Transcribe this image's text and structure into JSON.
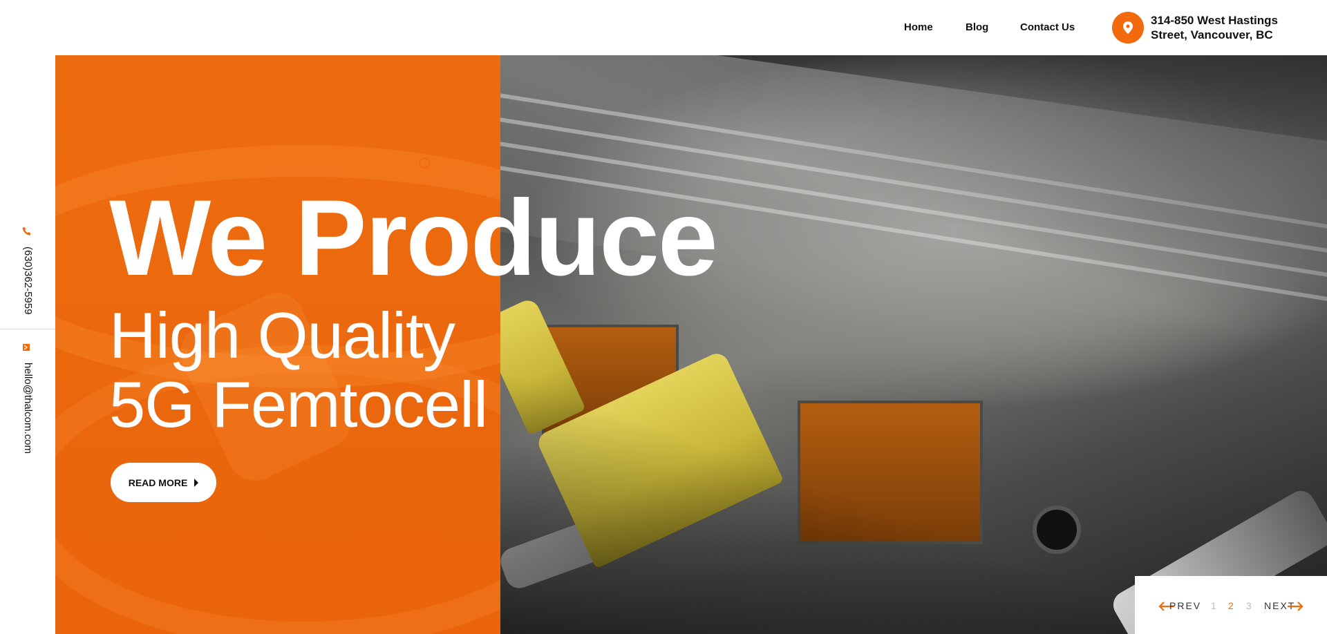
{
  "header": {
    "nav": [
      {
        "label": "Home"
      },
      {
        "label": "Blog"
      },
      {
        "label": "Contact Us"
      }
    ],
    "address_line1": "314-850 West Hastings",
    "address_line2": "Street, Vancouver, BC",
    "location_icon": "location-pin-icon"
  },
  "sidebar": {
    "phone": "(630)362-5959",
    "email": "hello@thalcom.com",
    "phone_icon": "phone-icon",
    "email_icon": "email-icon"
  },
  "hero": {
    "title": "We Produce",
    "subtitle_line1": "High Quality",
    "subtitle_line2": "5G Femtocell",
    "cta_label": "READ MORE"
  },
  "pager": {
    "prev_label": "PREV",
    "next_label": "NEXT",
    "pages": [
      "1",
      "2",
      "3"
    ],
    "current": "2"
  },
  "colors": {
    "accent": "#f26a0d",
    "hero_panel": "#eb670d",
    "text": "#111111",
    "background": "#ffffff"
  }
}
